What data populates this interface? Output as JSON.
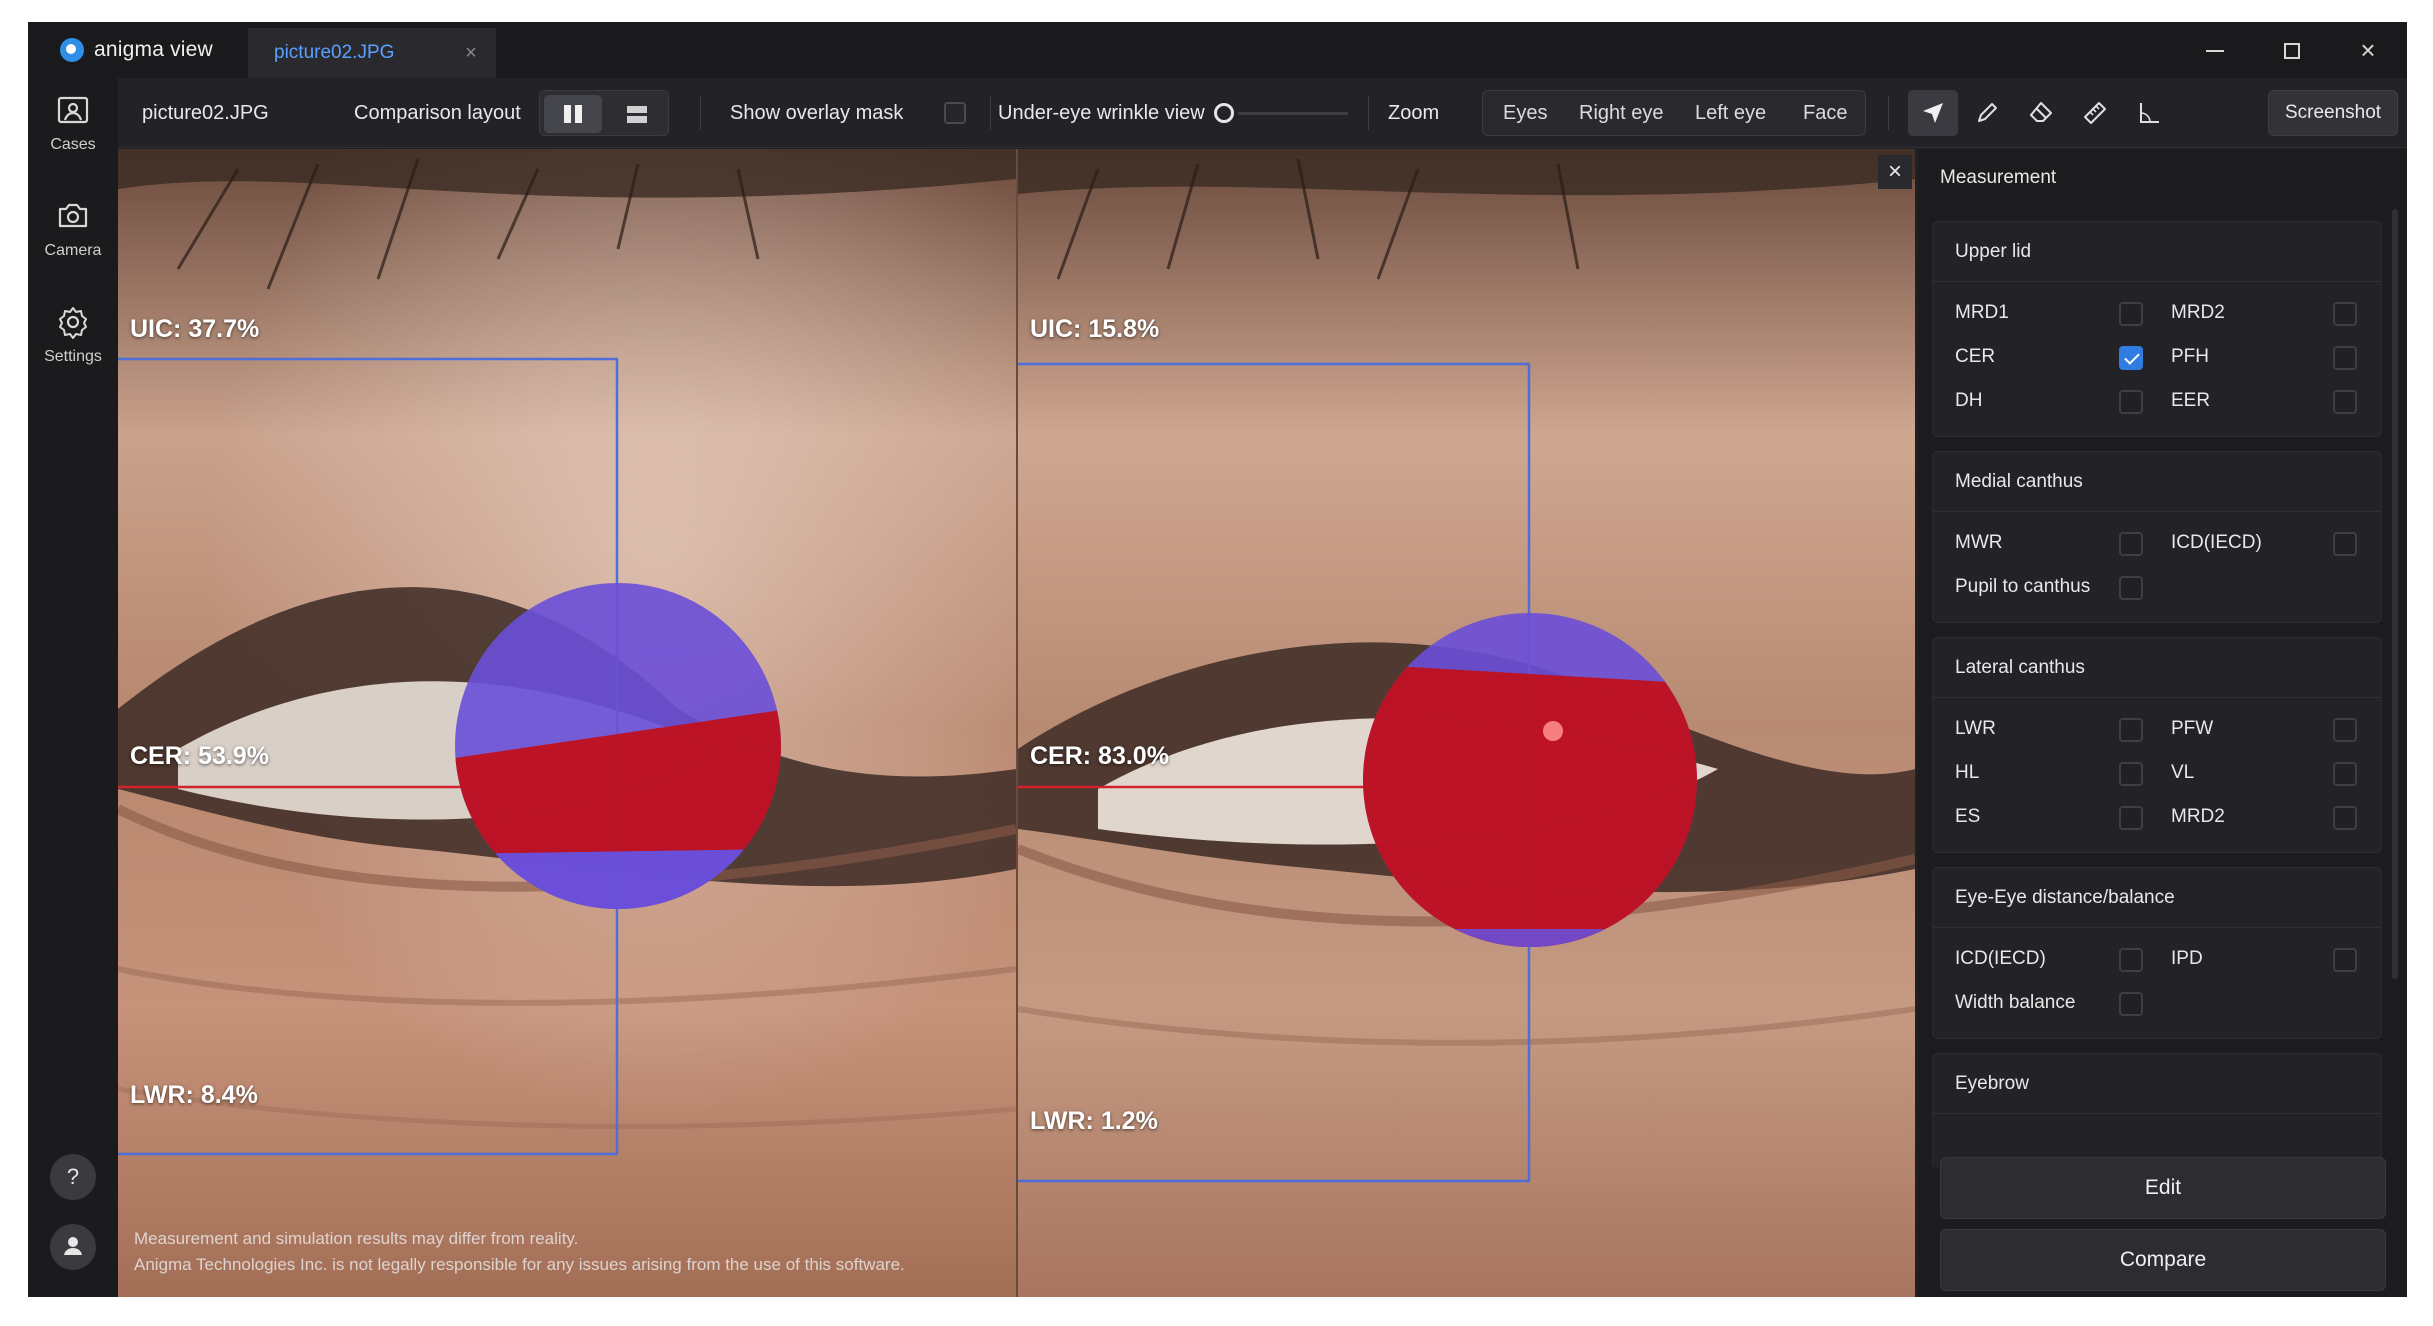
{
  "app": {
    "brand": "anigma view",
    "tab_title": "picture02.JPG",
    "tab_close": "×"
  },
  "window_controls": {
    "minimize": "minimize-icon",
    "maximize": "maximize-icon",
    "close": "×"
  },
  "rail": {
    "items": [
      {
        "label": "Cases",
        "icon": "cases-icon"
      },
      {
        "label": "Camera",
        "icon": "camera-icon"
      },
      {
        "label": "Settings",
        "icon": "gear-icon"
      }
    ],
    "help": "?",
    "user_icon": "user-icon"
  },
  "toolbar": {
    "filename": "picture02.JPG",
    "comparison_label": "Comparison layout",
    "comparison_selected": "side-by-side",
    "overlay_label": "Show overlay mask",
    "overlay_checked": false,
    "wrinkle_label": "Under-eye wrinkle view",
    "wrinkle_level": 0,
    "zoom_label": "Zoom",
    "zoom_options": [
      "Eyes",
      "Right eye",
      "Left eye",
      "Face"
    ],
    "tools": [
      "navigate-icon",
      "pen-icon",
      "eraser-icon",
      "ruler-icon",
      "angle-icon"
    ],
    "active_tool": "navigate-icon",
    "screenshot_label": "Screenshot"
  },
  "viewer": {
    "left": {
      "uic": "UIC: 37.7%",
      "cer": "CER: 53.9%",
      "lwr": "LWR: 8.4%"
    },
    "right": {
      "uic": "UIC: 15.8%",
      "cer": "CER: 83.0%",
      "lwr": "LWR: 1.2%"
    },
    "disclaimer_1": "Measurement and simulation results may differ from reality.",
    "disclaimer_2": "Anigma Technologies Inc. is not legally responsible for any issues arising from the use of this software.",
    "close": "×",
    "colors": {
      "upper_overlay": "#6a4fd8",
      "iris_overlay": "#c0101c",
      "guide": "#4f6fd8"
    }
  },
  "measurement": {
    "title": "Measurement",
    "upper_lid": {
      "title": "Upper lid",
      "items": [
        {
          "label": "MRD1",
          "checked": false
        },
        {
          "label": "MRD2",
          "checked": false
        },
        {
          "label": "CER",
          "checked": true
        },
        {
          "label": "PFH",
          "checked": false
        },
        {
          "label": "DH",
          "checked": false
        },
        {
          "label": "EER",
          "checked": false
        }
      ]
    },
    "medial_canthus": {
      "title": "Medial canthus",
      "items": [
        {
          "label": "MWR",
          "checked": false
        },
        {
          "label": "ICD(IECD)",
          "checked": false
        },
        {
          "label": "Pupil to canthus",
          "checked": false
        }
      ]
    },
    "lateral_canthus": {
      "title": "Lateral canthus",
      "items": [
        {
          "label": "LWR",
          "checked": false
        },
        {
          "label": "PFW",
          "checked": false
        },
        {
          "label": "HL",
          "checked": false
        },
        {
          "label": "VL",
          "checked": false
        },
        {
          "label": "ES",
          "checked": false
        },
        {
          "label": "MRD2",
          "checked": false
        }
      ]
    },
    "eye_eye": {
      "title": "Eye-Eye distance/balance",
      "items": [
        {
          "label": "ICD(IECD)",
          "checked": false
        },
        {
          "label": "IPD",
          "checked": false
        },
        {
          "label": "Width balance",
          "checked": false
        }
      ]
    },
    "eyebrow": {
      "title": "Eyebrow"
    },
    "edit_label": "Edit",
    "compare_label": "Compare",
    "accent": "#2f7de1"
  }
}
